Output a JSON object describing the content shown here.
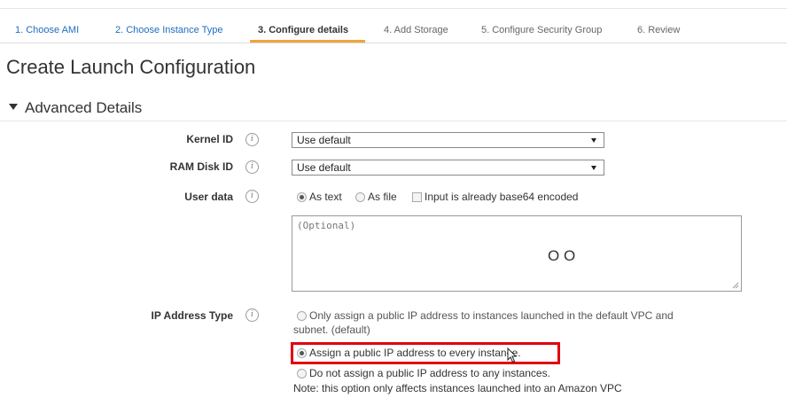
{
  "wizard": {
    "steps": [
      {
        "label": "1. Choose AMI",
        "state": "link"
      },
      {
        "label": "2. Choose Instance Type",
        "state": "link"
      },
      {
        "label": "3. Configure details",
        "state": "active"
      },
      {
        "label": "4. Add Storage",
        "state": "todo"
      },
      {
        "label": "5. Configure Security Group",
        "state": "todo"
      },
      {
        "label": "6. Review",
        "state": "todo"
      }
    ]
  },
  "page": {
    "title": "Create Launch Configuration"
  },
  "advanced": {
    "section_title": "Advanced Details",
    "kernel": {
      "label": "Kernel ID",
      "value": "Use default"
    },
    "ramdisk": {
      "label": "RAM Disk ID",
      "value": "Use default"
    },
    "user_data": {
      "label": "User data",
      "as_text": "As text",
      "as_file": "As file",
      "base64": "Input is already base64 encoded",
      "placeholder": "(Optional)",
      "glyphs": "O O"
    },
    "ip": {
      "label": "IP Address Type",
      "option1_line1": "Only assign a public IP address to instances launched in the default VPC and",
      "option1_line2": "subnet. (default)",
      "option2": "Assign a public IP address to every instance.",
      "option3": "Do not assign a public IP address to any instances.",
      "note": "Note: this option only affects instances launched into an Amazon VPC"
    }
  },
  "colors": {
    "link": "#1f6cc2",
    "active_tab": "#f0a33b",
    "highlight": "#e3000f"
  },
  "icons": {
    "info": "info-icon",
    "select_arrow": "dropdown-arrow-icon",
    "section_toggle": "caret-down-icon"
  }
}
